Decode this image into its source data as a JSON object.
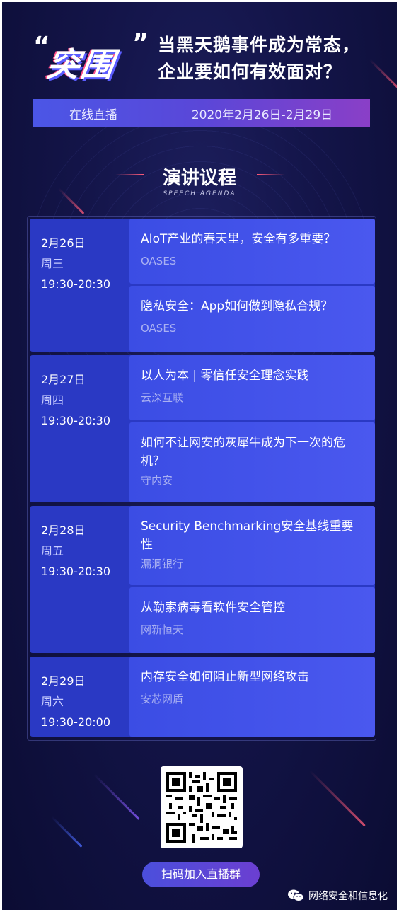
{
  "header": {
    "logo_text": "突围",
    "logo_quote_left": "“",
    "logo_quote_right": "”",
    "headline_line1": "当黑天鹅事件成为常态，",
    "headline_line2": "企业要如何有效面对？"
  },
  "live_bar": {
    "left_label": "在线直播",
    "date_range": "2020年2月26日-2月29日"
  },
  "agenda": {
    "title": "演讲议程",
    "subtitle": "SPEECH AGENDA",
    "days": [
      {
        "date": "2月26日",
        "weekday": "周三",
        "time": "19:30-20:30",
        "talks": [
          {
            "title": "AIoT产业的春天里，安全有多重要？",
            "org": "OASES"
          },
          {
            "title": "隐私安全：App如何做到隐私合规？",
            "org": "OASES"
          }
        ]
      },
      {
        "date": "2月27日",
        "weekday": "周四",
        "time": "19:30-20:30",
        "talks": [
          {
            "title": "以人为本 | 零信任安全理念实践",
            "org": "云深互联"
          },
          {
            "title": "如何不让网安的灰犀牛成为下一次的危机？",
            "org": "守内安"
          }
        ]
      },
      {
        "date": "2月28日",
        "weekday": "周五",
        "time": "19:30-20:30",
        "talks": [
          {
            "title": "Security Benchmarking安全基线重要性",
            "org": "漏洞银行"
          },
          {
            "title": "从勒索病毒看软件安全管控",
            "org": "网新恒天"
          }
        ]
      },
      {
        "date": "2月29日",
        "weekday": "周六",
        "time": "19:30-20:00",
        "talks": [
          {
            "title": "内存安全如何阻止新型网络攻击",
            "org": "安芯网盾"
          }
        ]
      }
    ]
  },
  "footer": {
    "scan_button": "扫码加入直播群",
    "watermark": "网络安全和信息化",
    "watermark_icon": "wechat-icon"
  },
  "colors": {
    "background": "#14154a",
    "day_block": "#2a39c4",
    "talk_block": "#4a58ef",
    "accent_pink": "#ff5b7a"
  }
}
